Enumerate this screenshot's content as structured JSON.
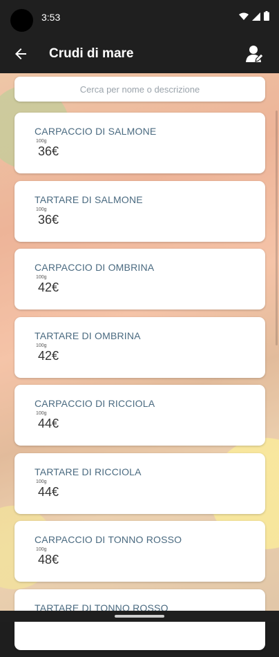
{
  "status_bar": {
    "time": "3:53"
  },
  "header": {
    "title": "Crudi di mare"
  },
  "search": {
    "placeholder": "Cerca per nome o descrizione"
  },
  "items": [
    {
      "name": "CARPACCIO DI SALMONE",
      "unit": "100g",
      "price": "36€"
    },
    {
      "name": "TARTARE DI SALMONE",
      "unit": "100g",
      "price": "36€"
    },
    {
      "name": "CARPACCIO DI OMBRINA",
      "unit": "100g",
      "price": "42€"
    },
    {
      "name": "TARTARE DI OMBRINA",
      "unit": "100g",
      "price": "42€"
    },
    {
      "name": "CARPACCIO DI RICCIOLA",
      "unit": "100g",
      "price": "44€"
    },
    {
      "name": "TARTARE DI RICCIOLA",
      "unit": "100g",
      "price": "44€"
    },
    {
      "name": "CARPACCIO DI TONNO ROSSO",
      "unit": "100g",
      "price": "48€"
    },
    {
      "name": "TARTARE DI TONNO ROSSO",
      "unit": "",
      "price": ""
    }
  ],
  "colors": {
    "bar": "#1f1f1f",
    "item_name": "#4a6a80",
    "card": "#ffffff"
  },
  "icons": [
    "camera-cutout",
    "wifi-icon",
    "signal-icon",
    "battery-icon",
    "back-arrow-icon",
    "user-account-icon"
  ]
}
